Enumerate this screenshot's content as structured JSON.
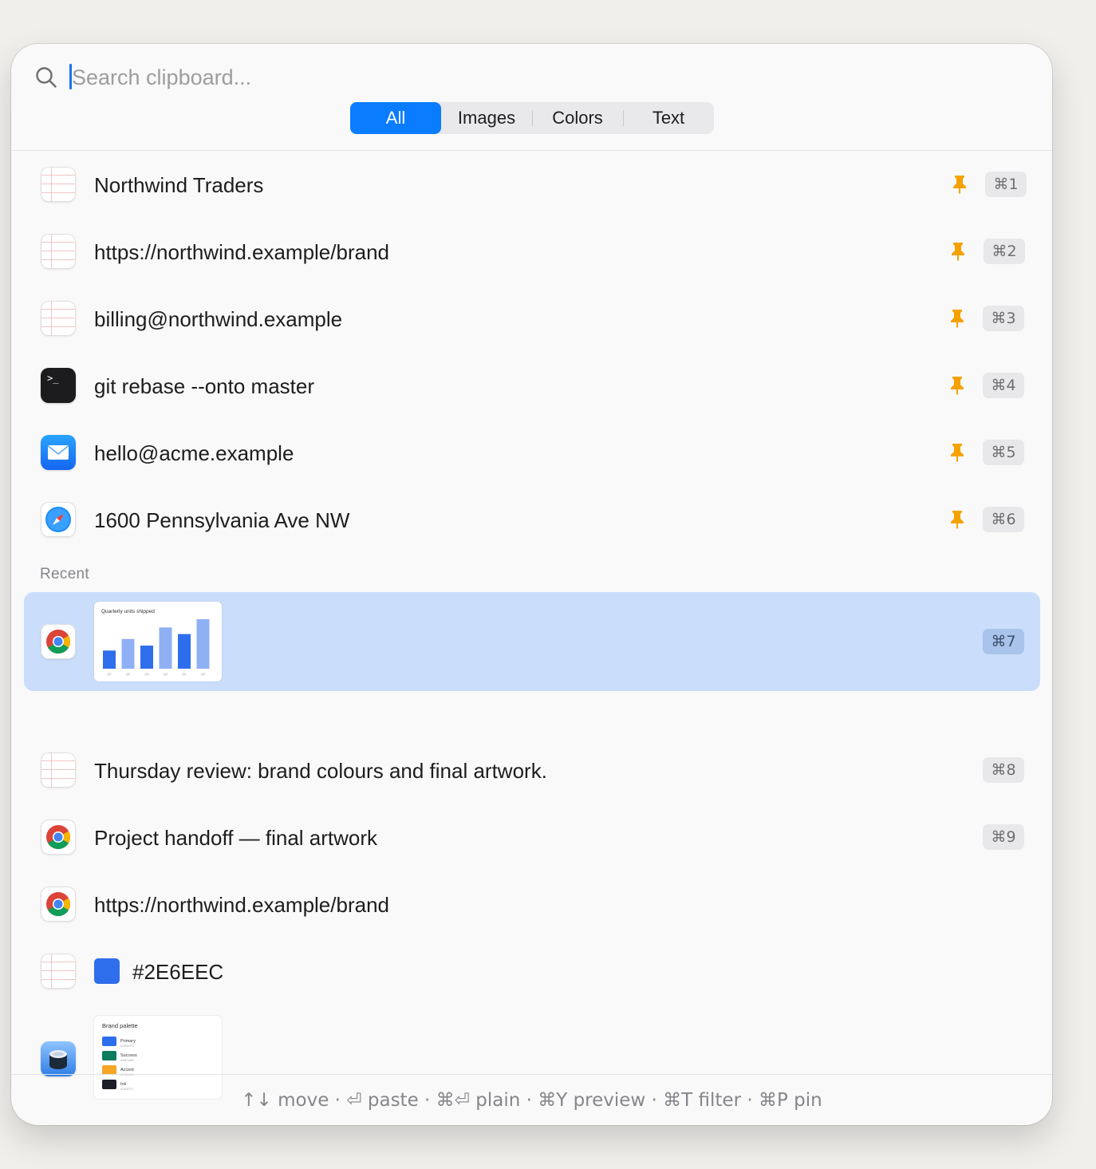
{
  "search": {
    "placeholder": "Search clipboard..."
  },
  "filters": [
    {
      "label": "All",
      "active": true
    },
    {
      "label": "Images",
      "active": false
    },
    {
      "label": "Colors",
      "active": false
    },
    {
      "label": "Text",
      "active": false
    }
  ],
  "pinned": [
    {
      "text": "Northwind Traders",
      "app": "notes-icon",
      "shortcut": "⌘1"
    },
    {
      "text": "https://northwind.example/brand",
      "app": "notes-icon",
      "shortcut": "⌘2"
    },
    {
      "text": "billing@northwind.example",
      "app": "notes-icon",
      "shortcut": "⌘3"
    },
    {
      "text": "git rebase --onto master",
      "app": "terminal-icon",
      "shortcut": "⌘4"
    },
    {
      "text": "hello@acme.example",
      "app": "mail-icon",
      "shortcut": "⌘5"
    },
    {
      "text": "1600 Pennsylvania Ave NW",
      "app": "safari-icon",
      "shortcut": "⌘6"
    }
  ],
  "section_recent": "Recent",
  "recent": {
    "chart_item": {
      "app": "chrome-icon",
      "shortcut": "⌘7",
      "thumbnail": {
        "title": "Quarterly units shipped",
        "categories": [
          "Q1",
          "Q2",
          "Q3",
          "Q4",
          "Q1",
          "Q2"
        ],
        "values": [
          22,
          36,
          28,
          50,
          42,
          60
        ]
      }
    },
    "thursday": {
      "text": "Thursday review: brand colours and final artwork.",
      "app": "notes-icon",
      "shortcut": "⌘8"
    },
    "handoff": {
      "text": "Project handoff — final artwork",
      "app": "chrome-icon",
      "shortcut": "⌘9"
    },
    "url": {
      "text": "https://northwind.example/brand",
      "app": "chrome-icon"
    },
    "color": {
      "text": "#2E6EEC",
      "app": "notes-icon",
      "swatch": "#2E6EEC"
    },
    "palette_item": {
      "app": "preview-icon",
      "thumbnail": {
        "title": "Brand palette",
        "swatches": [
          {
            "name": "Primary",
            "hex": "#2E6EEC",
            "color": "#2E6EEC"
          },
          {
            "name": "Success",
            "hex": "#0B7A5E",
            "color": "#0B7A5E"
          },
          {
            "name": "Accent",
            "hex": "#F5A623",
            "color": "#F5A623"
          },
          {
            "name": "Ink",
            "hex": "#1B1F27",
            "color": "#1B1F27"
          }
        ]
      }
    }
  },
  "footer": {
    "hint": "↑↓ move · ⏎ paste · ⌘⏎ plain · ⌘Y preview · ⌘T filter · ⌘P pin"
  },
  "colors": {
    "accent": "#0A7CFF",
    "selected_row": "#CADEFB",
    "pin": "#F5A200"
  }
}
